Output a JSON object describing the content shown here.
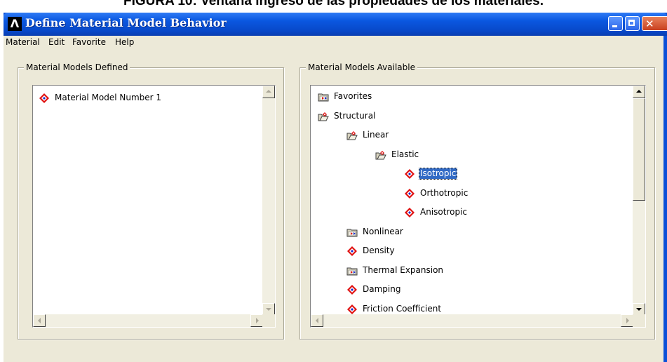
{
  "caption": "FIGURA 10: Ventana ingreso de las propiedades de los materiales.",
  "window": {
    "title": "Define Material Model Behavior",
    "logo_glyph": "Λ"
  },
  "menu": [
    "Material",
    "Edit",
    "Favorite",
    "Help"
  ],
  "defined_panel": {
    "label": "Material Models Defined",
    "items": [
      {
        "label": "Material Model Number 1",
        "icon": "material-model-icon"
      }
    ]
  },
  "available_panel": {
    "label": "Material Models Available",
    "tree": [
      {
        "label": "Favorites",
        "icon": "folder-closed-icon",
        "depth": 0
      },
      {
        "label": "Structural",
        "icon": "folder-open-icon",
        "depth": 0
      },
      {
        "label": "Linear",
        "icon": "folder-open-icon",
        "depth": 1
      },
      {
        "label": "Elastic",
        "icon": "folder-open-icon",
        "depth": 2
      },
      {
        "label": "Isotropic",
        "icon": "material-model-icon",
        "depth": 3,
        "selected": true
      },
      {
        "label": "Orthotropic",
        "icon": "material-model-icon",
        "depth": 3
      },
      {
        "label": "Anisotropic",
        "icon": "material-model-icon",
        "depth": 3
      },
      {
        "label": "Nonlinear",
        "icon": "folder-closed-icon",
        "depth": 1
      },
      {
        "label": "Density",
        "icon": "material-model-icon",
        "depth": 1
      },
      {
        "label": "Thermal Expansion",
        "icon": "folder-closed-icon",
        "depth": 1
      },
      {
        "label": "Damping",
        "icon": "material-model-icon",
        "depth": 1
      },
      {
        "label": "Friction Coefficient",
        "icon": "material-model-icon",
        "depth": 1
      }
    ]
  },
  "colors": {
    "titlebar": "#0a57e0",
    "dialog_bg": "#ece9d8",
    "selection": "#316ac5",
    "model_icon_red": "#e01010",
    "model_icon_blue": "#1028d0"
  }
}
